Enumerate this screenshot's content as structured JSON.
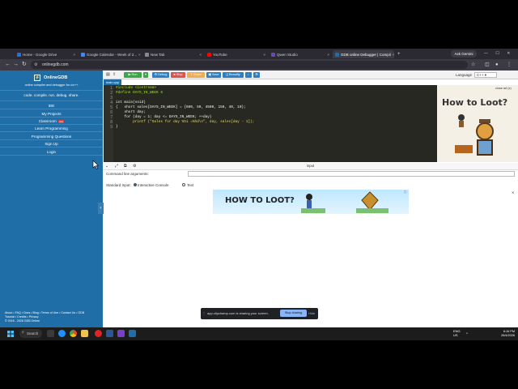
{
  "browser": {
    "tabs": [
      {
        "label": "Home - Google Drive",
        "color": "#1a73e8"
      },
      {
        "label": "Google Calendar - Week of 2...",
        "color": "#4285f4"
      },
      {
        "label": "New Tab",
        "color": "#888888"
      },
      {
        "label": "YouTube",
        "color": "#ff0000"
      },
      {
        "label": "Qwen Studio",
        "color": "#6b46c1"
      },
      {
        "label": "GDB online Debugger | Compil",
        "color": "#1f6ea8"
      }
    ],
    "new_tab": "+",
    "ask_gemini": "Ask Gemini",
    "url": "onlinegdb.com"
  },
  "sidebar": {
    "logo": "OnlineGDB",
    "tagline": "online compiler and debugger for c/c++",
    "quicklinks": "code. compile. run. debug. share.",
    "menu": [
      "IDE",
      "My Projects",
      "Classroom",
      "Learn Programming",
      "Programming Questions",
      "Sign Up",
      "Login"
    ],
    "classroom_badge": "new",
    "footer_line1": "About • FAQ • Docs • Blog • Terms of Use • Contact Us • GDB",
    "footer_line2": "Tutorial • Credits • Privacy",
    "footer_line3": "© 2016 - 2026 GDB Online"
  },
  "toolbar": {
    "run": "Run",
    "debug": "Debug",
    "stop": "Stop",
    "share": "Share",
    "save": "Save",
    "beautify": "{} Beautify",
    "language_label": "Language",
    "language_value": "C++"
  },
  "editor": {
    "filename": "main.cpp",
    "lines": [
      "#include <iostream>",
      "#define DAYS_IN_WEEK 6",
      "",
      "int main(void)",
      "{   short sales[DAYS_IN_WEEK] = {600, 50, 4500, 150, 40, 10};",
      "    short day;",
      "    for (day = 1; day <= DAYS_IN_WEEK; ++day)",
      "        printf (\"Sales for day %hi =%hd\\n\", day, sales[day - 1]);",
      "}"
    ]
  },
  "ad": {
    "close": "close ad (x)",
    "title": "How to Loot?"
  },
  "input_panel": {
    "title": "input",
    "cmd_label": "Command line arguments:",
    "stdin_label": "Standard Input:",
    "opt_interactive": "Interactive Console",
    "opt_text": "Text",
    "banner_text": "HOW TO LOOT?"
  },
  "share_notice": {
    "text": "app.clipchamp.com is sharing your screen.",
    "stop": "Stop sharing",
    "hide": "Hide"
  },
  "taskbar": {
    "search": "Search",
    "tray_lang": "ENG",
    "tray_region": "US",
    "time": "6:16 PM",
    "date": "26/4/2026"
  }
}
